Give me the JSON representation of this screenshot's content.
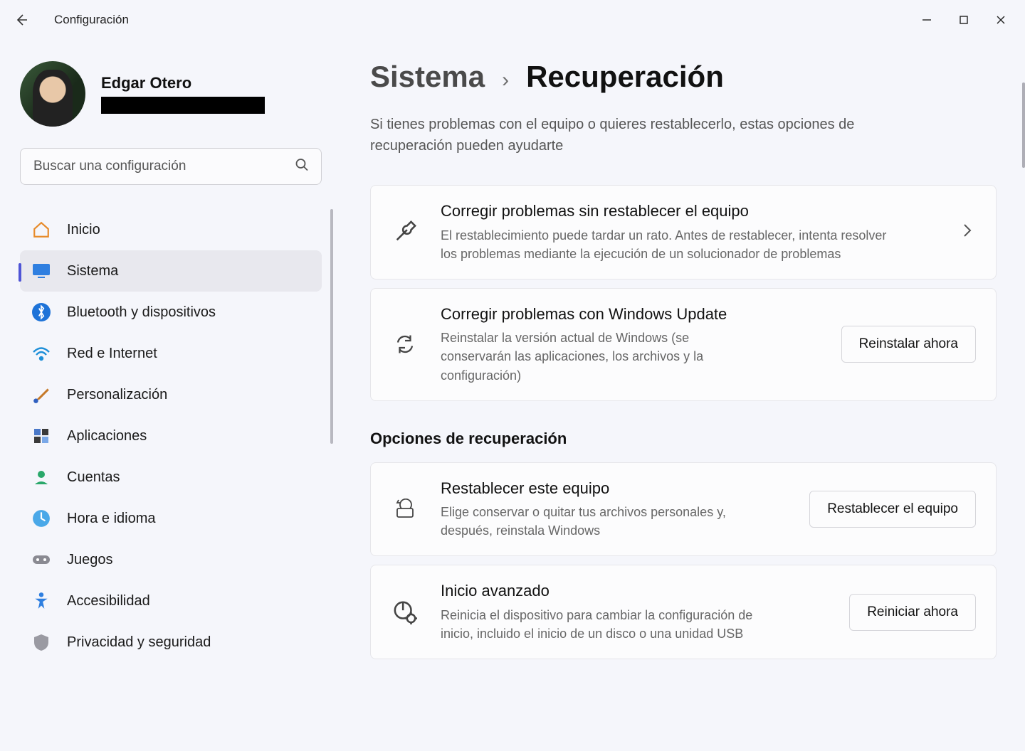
{
  "window": {
    "title": "Configuración"
  },
  "profile": {
    "name": "Edgar Otero"
  },
  "search": {
    "placeholder": "Buscar una configuración"
  },
  "sidebar": {
    "items": [
      {
        "label": "Inicio"
      },
      {
        "label": "Sistema"
      },
      {
        "label": "Bluetooth y dispositivos"
      },
      {
        "label": "Red e Internet"
      },
      {
        "label": "Personalización"
      },
      {
        "label": "Aplicaciones"
      },
      {
        "label": "Cuentas"
      },
      {
        "label": "Hora e idioma"
      },
      {
        "label": "Juegos"
      },
      {
        "label": "Accesibilidad"
      },
      {
        "label": "Privacidad y seguridad"
      }
    ],
    "selected_index": 1
  },
  "breadcrumb": {
    "parent": "Sistema",
    "separator": "›",
    "current": "Recuperación"
  },
  "subtitle": "Si tienes problemas con el equipo o quieres restablecerlo, estas opciones de recuperación pueden ayudarte",
  "cards": [
    {
      "title": "Corregir problemas sin restablecer el equipo",
      "desc": "El restablecimiento puede tardar un rato. Antes de restablecer, intenta resolver los problemas mediante la ejecución de un solucionador de problemas",
      "action_type": "chevron"
    },
    {
      "title": "Corregir problemas con Windows Update",
      "desc": "Reinstalar la versión actual de Windows (se conservarán las aplicaciones, los archivos y la configuración)",
      "action_type": "button",
      "button_label": "Reinstalar ahora"
    }
  ],
  "section2_title": "Opciones de recuperación",
  "cards2": [
    {
      "title": "Restablecer este equipo",
      "desc": "Elige conservar o quitar tus archivos personales y, después, reinstala Windows",
      "button_label": "Restablecer el equipo"
    },
    {
      "title": "Inicio avanzado",
      "desc": "Reinicia el dispositivo para cambiar la configuración de inicio, incluido el inicio de un disco o una unidad USB",
      "button_label": "Reiniciar ahora"
    }
  ],
  "colors": {
    "arrow": "#d8140b"
  }
}
